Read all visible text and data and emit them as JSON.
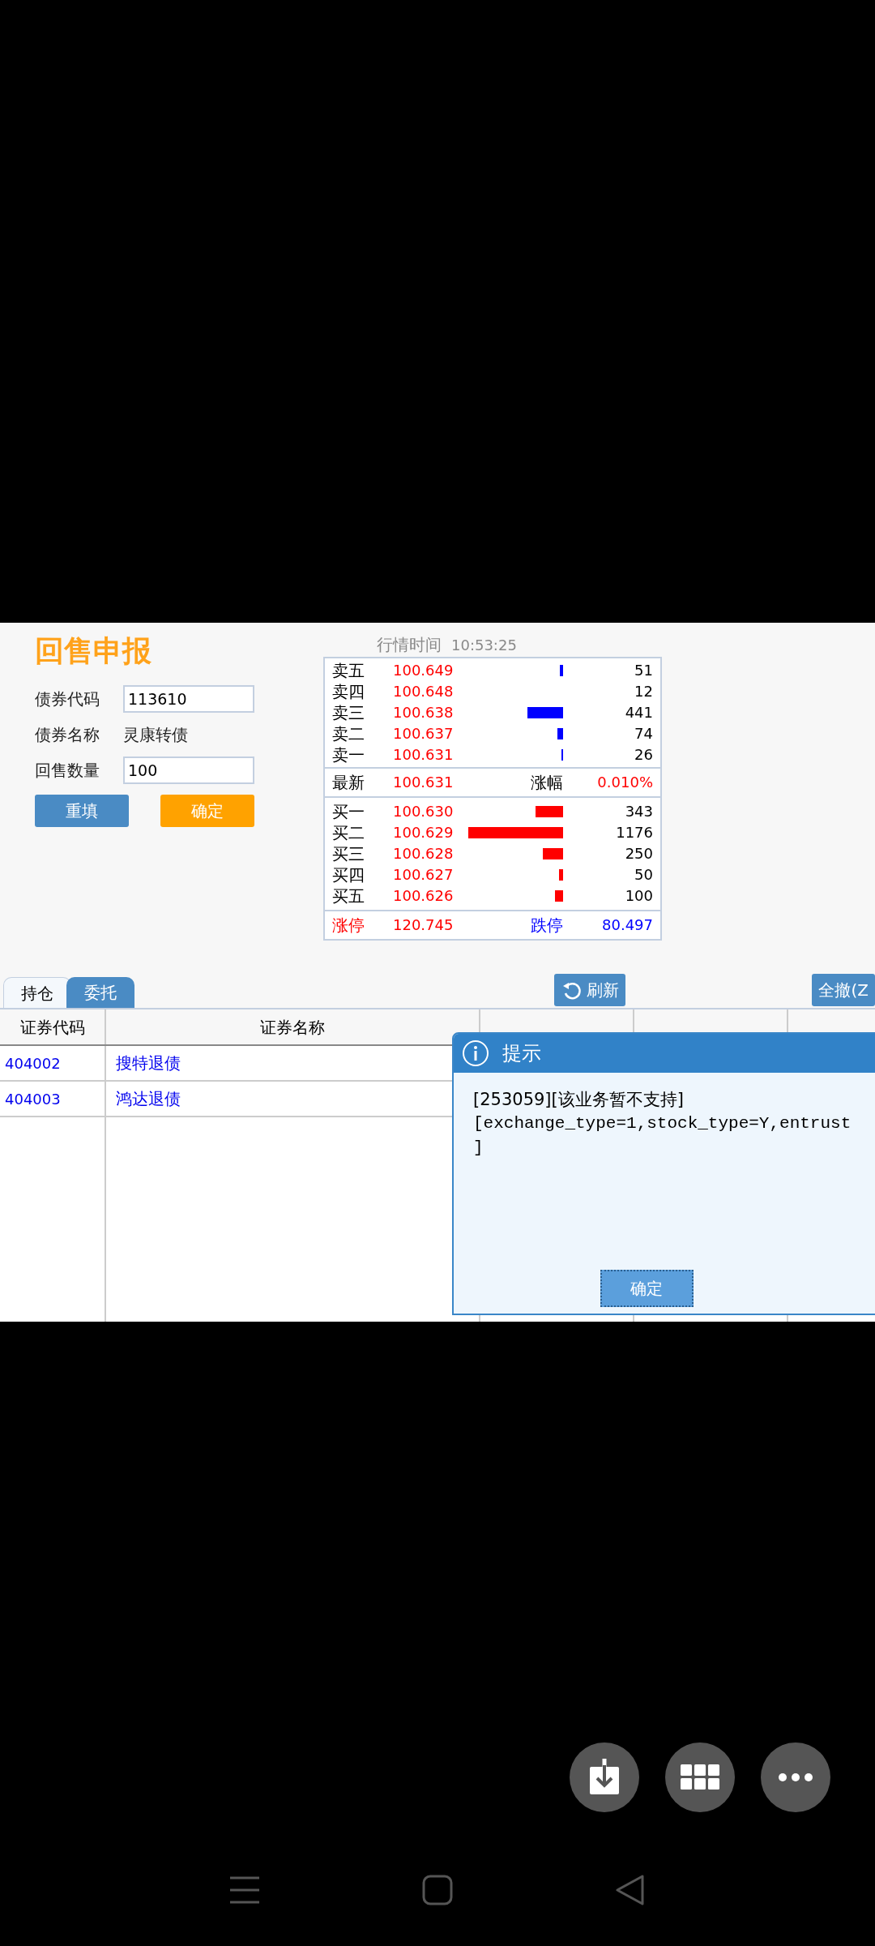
{
  "title": "回售申报",
  "form": {
    "fields": [
      {
        "kind": "input",
        "label": "债券代码",
        "value": "113610"
      },
      {
        "kind": "text",
        "label": "债券名称",
        "value": "灵康转债"
      },
      {
        "kind": "input",
        "label": "回售数量",
        "value": "100"
      }
    ],
    "buttons": [
      {
        "kind": "secondary",
        "label": "重填"
      },
      {
        "kind": "primary",
        "label": "确定"
      }
    ]
  },
  "quote": {
    "time_label": "行情时间",
    "time": "10:53:25",
    "asks": [
      {
        "label": "卖五",
        "price": "100.649",
        "qty": "51",
        "level": 0.035
      },
      {
        "label": "卖四",
        "price": "100.648",
        "qty": "12"
      },
      {
        "label": "卖三",
        "price": "100.638",
        "qty": "441",
        "level": 0.375
      },
      {
        "label": "卖二",
        "price": "100.637",
        "qty": "74",
        "level": 0.063
      },
      {
        "label": "卖一",
        "price": "100.631",
        "qty": "26",
        "level": 0.02
      }
    ],
    "latest": {
      "label": "最新",
      "price": "100.631",
      "change_label": "涨幅",
      "change": "0.010%"
    },
    "bids": [
      {
        "label": "买一",
        "price": "100.630",
        "qty": "343",
        "level": 0.29
      },
      {
        "label": "买二",
        "price": "100.629",
        "qty": "1176",
        "level": 1
      },
      {
        "label": "买三",
        "price": "100.628",
        "qty": "250",
        "level": 0.21
      },
      {
        "label": "买四",
        "price": "100.627",
        "qty": "50",
        "level": 0.04
      },
      {
        "label": "买五",
        "price": "100.626",
        "qty": "100",
        "level": 0.085
      }
    ],
    "limits": [
      {
        "kind": "up",
        "label": "涨停",
        "value": "120.745"
      },
      {
        "kind": "down",
        "label": "跌停",
        "value": "80.497"
      }
    ]
  },
  "tabs": [
    {
      "label": "持仓",
      "selected": true
    },
    {
      "label": "委托",
      "selected": false
    }
  ],
  "toolbar": [
    {
      "kind": "refresh",
      "label": "刷新"
    },
    {
      "kind": "cancel",
      "label": "全撤(Z"
    }
  ],
  "table": {
    "columns": [
      "证券代码",
      "证券名称"
    ],
    "rows": [
      [
        "404002",
        "搜特退债"
      ],
      [
        "404003",
        "鸿达退债"
      ]
    ]
  },
  "dialog": {
    "title": "提示",
    "lines": [
      {
        "kind": "text",
        "text": "[253059][该业务暂不支持]"
      },
      {
        "kind": "code",
        "text": "[exchange_type=1,stock_type=Y,entrust"
      },
      {
        "kind": "code",
        "text": "]"
      }
    ],
    "button": "确定"
  }
}
